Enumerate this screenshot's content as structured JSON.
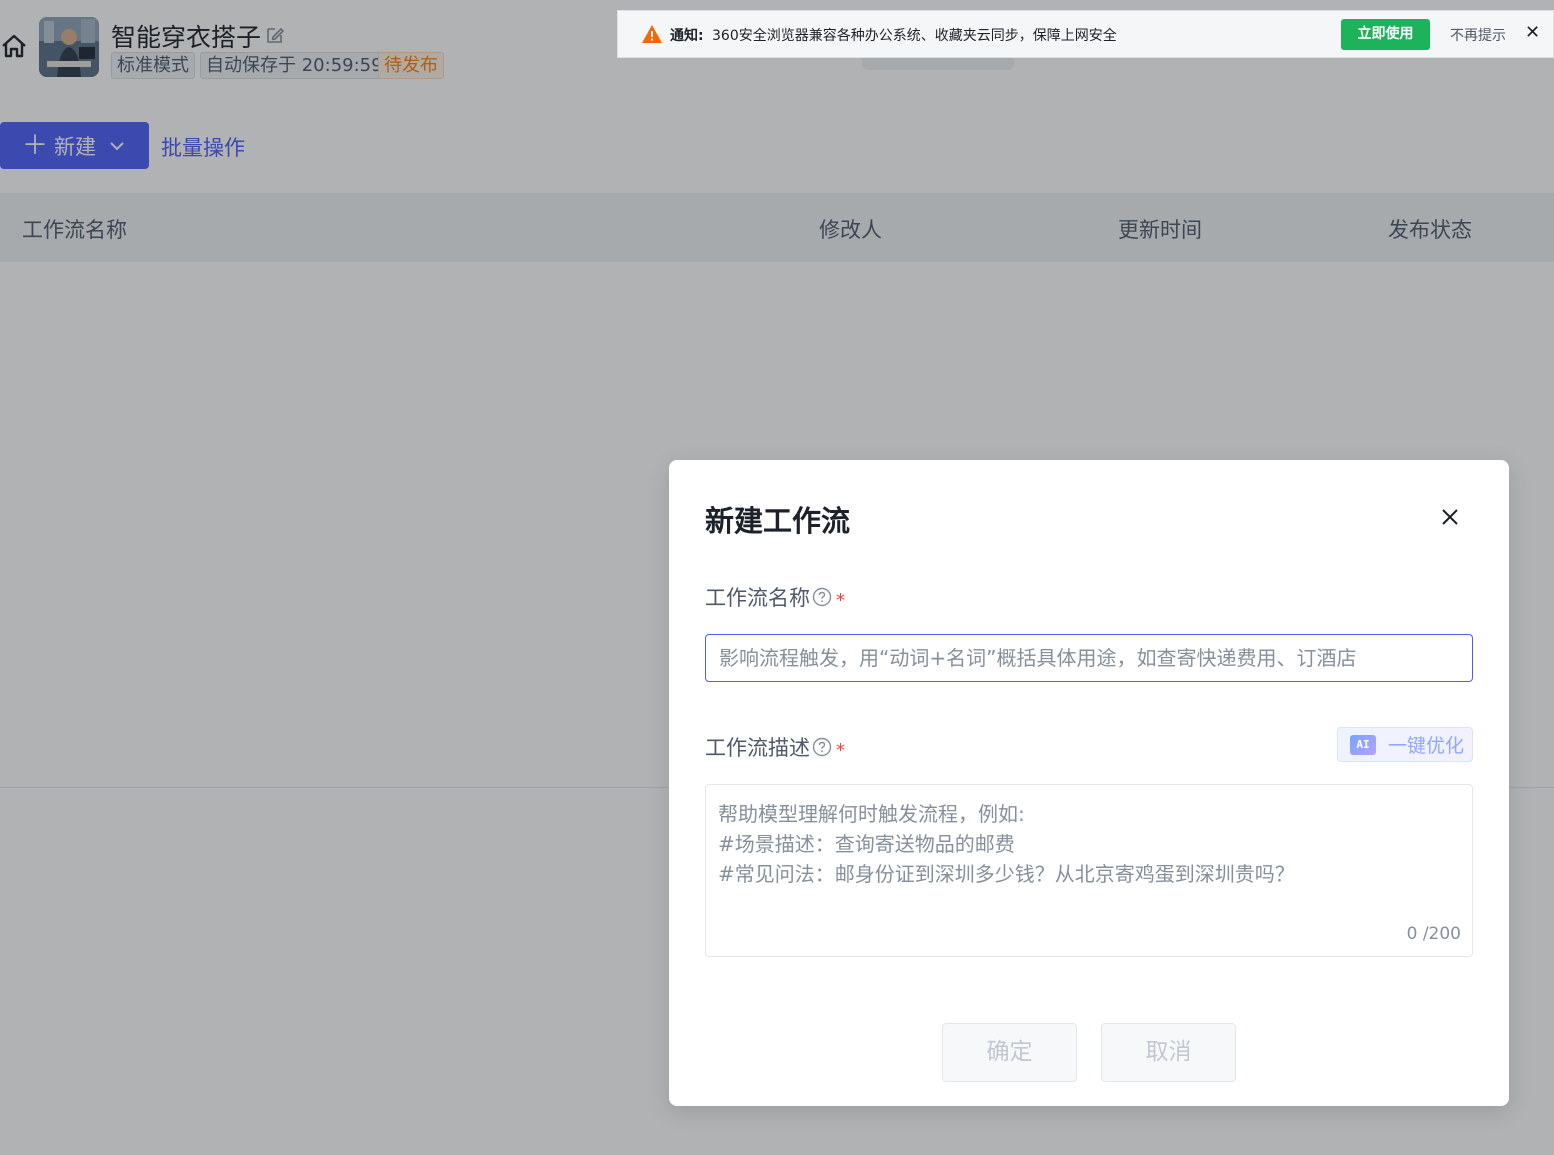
{
  "app": {
    "title": "智能穿衣搭子",
    "tags": {
      "mode": "标准模式",
      "autosave": "自动保存于 20:59:59",
      "status": "待发布"
    }
  },
  "toolbar": {
    "new_label": "新建",
    "batch_label": "批量操作"
  },
  "table": {
    "columns": [
      "工作流名称",
      "修改人",
      "更新时间",
      "发布状态"
    ]
  },
  "notification": {
    "label": "通知:",
    "text": "360安全浏览器兼容各种办公系统、收藏夹云同步，保障上网安全",
    "action": "立即使用",
    "dismiss": "不再提示",
    "close": "✕"
  },
  "modal": {
    "title": "新建工作流",
    "name_label": "工作流名称",
    "name_placeholder": "影响流程触发，用“动词+名词”概括具体用途，如查寄快递费用、订酒店",
    "name_value": "",
    "desc_label": "工作流描述",
    "desc_placeholder": "帮助模型理解何时触发流程，例如:\n#场景描述：查询寄送物品的邮费\n#常见问法：邮身份证到深圳多少钱？从北京寄鸡蛋到深圳贵吗？",
    "desc_counter": "0 /200",
    "ai_badge": "AI",
    "ai_label": "一键优化",
    "required_mark": "*",
    "confirm_label": "确定",
    "cancel_label": "取消"
  },
  "colors": {
    "primary": "#4e5ef6",
    "pending": "#ff7d00",
    "success_button": "#1db35a",
    "required": "#f53f3f"
  }
}
